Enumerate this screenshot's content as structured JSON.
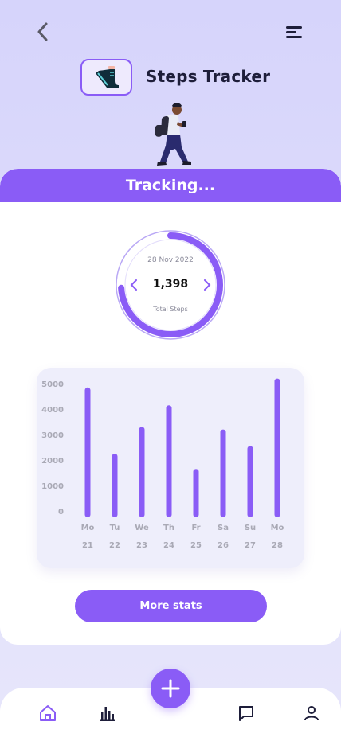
{
  "header": {
    "title": "Steps Tracker",
    "back_icon": "chevron-left-icon",
    "menu_icon": "menu-icon"
  },
  "card": {
    "header_label": "Tracking..."
  },
  "ring": {
    "date": "28 Nov 2022",
    "steps": "1,398",
    "label": "Total Steps",
    "progress": 0.74
  },
  "chart_data": {
    "type": "bar",
    "title": "",
    "xlabel": "",
    "ylabel": "",
    "ylim": [
      0,
      5000
    ],
    "yticks": [
      "5000",
      "4000",
      "3000",
      "2000",
      "1000",
      "0"
    ],
    "categories": [
      "Mo",
      "Tu",
      "We",
      "Th",
      "Fr",
      "Sa",
      "Su",
      "Mo"
    ],
    "dates": [
      "21",
      "22",
      "23",
      "24",
      "25",
      "26",
      "27",
      "28"
    ],
    "values": [
      4850,
      2250,
      3300,
      4150,
      1650,
      3200,
      2550,
      5200
    ],
    "grid": false
  },
  "buttons": {
    "more_stats": "More stats"
  },
  "nav": {
    "items": [
      "home-icon",
      "chart-icon",
      "message-icon",
      "profile-icon"
    ],
    "fab_icon": "plus-icon"
  },
  "colors": {
    "accent": "#8a5cf6",
    "background": "#dcdafa",
    "text": "#1e1e3a"
  }
}
